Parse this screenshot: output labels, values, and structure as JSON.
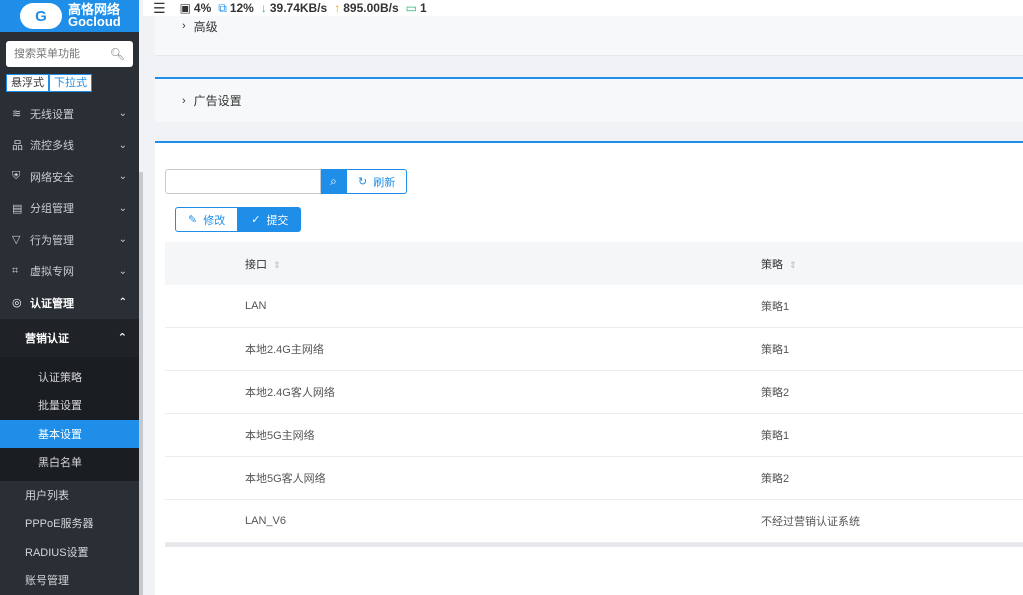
{
  "brand": {
    "name_cn": "高恪网络",
    "name_en": "Gocloud",
    "logo_letter": "G"
  },
  "sidebar": {
    "search_placeholder": "搜索菜单功能",
    "mode_buttons": [
      "悬浮式",
      "下拉式"
    ],
    "items": [
      {
        "label": "无线设置",
        "icon": "≋"
      },
      {
        "label": "流控多线",
        "icon": "品"
      },
      {
        "label": "网络安全",
        "icon": "⛨"
      },
      {
        "label": "分组管理",
        "icon": "▤"
      },
      {
        "label": "行为管理",
        "icon": "▽"
      },
      {
        "label": "虚拟专网",
        "icon": "⌗"
      },
      {
        "label": "认证管理",
        "icon": "◎"
      }
    ],
    "sub_open": "营销认证",
    "sub_leaves": [
      "认证策略",
      "批量设置",
      "基本设置",
      "黑白名单"
    ],
    "active_leaf": "基本设置",
    "more_leaves": [
      "用户列表",
      "PPPoE服务器",
      "RADIUS设置",
      "账号管理"
    ]
  },
  "topbar": {
    "cpu": "4%",
    "mem": "12%",
    "down": "39.74KB/s",
    "up": "895.00B/s",
    "devices": "1"
  },
  "panels": {
    "advanced": "高级",
    "ad": "广告设置"
  },
  "toolbar": {
    "search_value": "",
    "refresh": "刷新",
    "edit": "修改",
    "submit": "提交"
  },
  "table": {
    "headers": [
      "接口",
      "策略"
    ],
    "rows": [
      [
        "LAN",
        "策略1"
      ],
      [
        "本地2.4G主网络",
        "策略1"
      ],
      [
        "本地2.4G客人网络",
        "策略2"
      ],
      [
        "本地5G主网络",
        "策略1"
      ],
      [
        "本地5G客人网络",
        "策略2"
      ],
      [
        "LAN_V6",
        "不经过营销认证系统"
      ]
    ]
  },
  "colors": {
    "accent": "#1e8ee8",
    "sidebar": "#2a2f35"
  }
}
